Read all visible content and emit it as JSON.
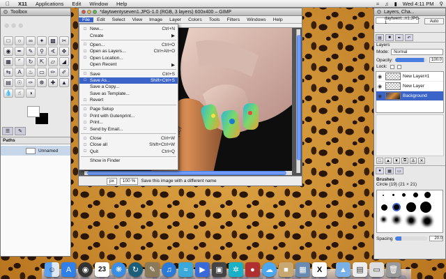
{
  "menubar": {
    "app_name": "X11",
    "items": [
      "Applications",
      "Edit",
      "Window",
      "Help"
    ],
    "clock": "Wed 4:11 PM"
  },
  "toolbox": {
    "title": "Toolbox",
    "paths_title": "Paths",
    "path_name": "Unnamed"
  },
  "image_window": {
    "title": "*daytwentyseven1.JPG-1.0 (RGB, 3 layers) 600x400 – GIMP",
    "menus": [
      "File",
      "Edit",
      "Select",
      "View",
      "Image",
      "Layer",
      "Colors",
      "Tools",
      "Filters",
      "Windows",
      "Help"
    ],
    "status_unit": "px",
    "status_zoom": "100 %",
    "status_message": "Save this image with a different name",
    "canvas_label_text": "lacquer"
  },
  "file_menu": {
    "items": [
      {
        "label": "New...",
        "accel": "Ctrl+N",
        "icon": "new-icon"
      },
      {
        "label": "Create",
        "accel": "▶",
        "icon": ""
      },
      {
        "label": "Open...",
        "accel": "Ctrl+O",
        "icon": "open-icon"
      },
      {
        "label": "Open as Layers...",
        "accel": "Ctrl+Alt+O",
        "icon": "open-layers-icon"
      },
      {
        "label": "Open Location...",
        "accel": "",
        "icon": "location-icon"
      },
      {
        "label": "Open Recent",
        "accel": "▶",
        "icon": ""
      },
      {
        "label": "Save",
        "accel": "Ctrl+S",
        "icon": "save-icon"
      },
      {
        "label": "Save As...",
        "accel": "Shift+Ctrl+S",
        "icon": "save-as-icon"
      },
      {
        "label": "Save a Copy...",
        "accel": "",
        "icon": ""
      },
      {
        "label": "Save as Template...",
        "accel": "",
        "icon": ""
      },
      {
        "label": "Revert",
        "accel": "",
        "icon": "revert-icon"
      },
      {
        "label": "Page Setup",
        "accel": "",
        "icon": "page-setup-icon"
      },
      {
        "label": "Print with Gutenprint...",
        "accel": "",
        "icon": "print-icon"
      },
      {
        "label": "Print...",
        "accel": "",
        "icon": "print-icon"
      },
      {
        "label": "Send by Email...",
        "accel": "",
        "icon": "email-icon"
      },
      {
        "label": "Close",
        "accel": "Ctrl+W",
        "icon": "close-icon"
      },
      {
        "label": "Close all",
        "accel": "Shift+Ctrl+W",
        "icon": "close-all-icon"
      },
      {
        "label": "Quit",
        "accel": "Ctrl+Q",
        "icon": "quit-icon"
      },
      {
        "label": "Show in Finder",
        "accel": "",
        "icon": ""
      }
    ],
    "selected_index": 7
  },
  "layers_panel": {
    "title": "Layers, Cha...",
    "image_selector": "daytwent...n1.JPG-1",
    "auto_label": "Auto",
    "layers_title": "Layers",
    "mode_label": "Mode:",
    "mode_value": "Normal",
    "opacity_label": "Opacity:",
    "opacity_value": "100.0",
    "lock_label": "Lock:",
    "layers": [
      {
        "name": "New Layer#1",
        "selected": false
      },
      {
        "name": "New Layer",
        "selected": false
      },
      {
        "name": "Background",
        "selected": true
      }
    ],
    "brushes_title": "Brushes",
    "brush_name": "Circle (19) (21 × 21)",
    "spacing_label": "Spacing",
    "spacing_value": "20.0"
  },
  "colors": {
    "accent": "#3c64c8"
  }
}
